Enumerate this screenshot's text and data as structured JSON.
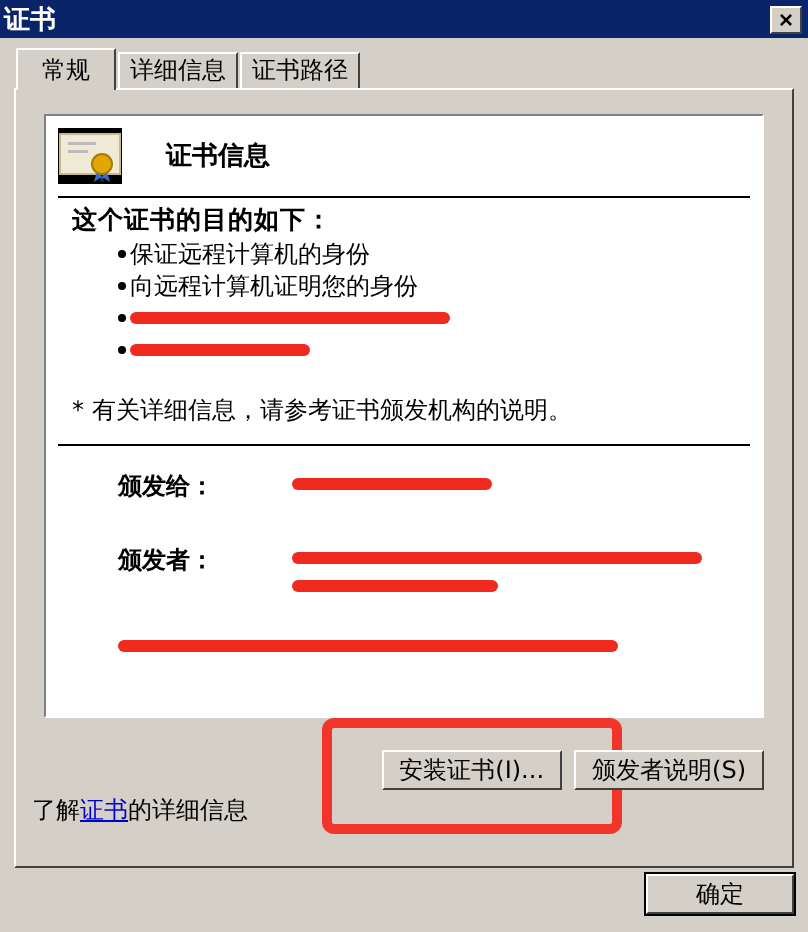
{
  "window": {
    "title": "证书",
    "close_label": "×"
  },
  "tabs": [
    {
      "label": "常规",
      "selected": true
    },
    {
      "label": "详细信息",
      "selected": false
    },
    {
      "label": "证书路径",
      "selected": false
    }
  ],
  "info": {
    "heading": "证书信息",
    "purpose_title": "这个证书的目的如下：",
    "purposes": [
      {
        "kind": "text",
        "text": "保证远程计算机的身份"
      },
      {
        "kind": "text",
        "text": "向远程计算机证明您的身份"
      },
      {
        "kind": "redacted"
      },
      {
        "kind": "redacted"
      }
    ],
    "note": "* 有关详细信息，请参考证书颁发机构的说明。",
    "fields": [
      {
        "kind": "single",
        "label": "颁发给："
      },
      {
        "kind": "double",
        "label": "颁发者："
      },
      {
        "kind": "redacted"
      }
    ]
  },
  "buttons": [
    {
      "label": "安装证书(I)...",
      "highlighted": true
    },
    {
      "label": "颁发者说明(S)",
      "highlighted": false
    }
  ],
  "learn_more": {
    "before": "了解",
    "link": "证书",
    "after": "的详细信息"
  },
  "ok_button": "确定"
}
